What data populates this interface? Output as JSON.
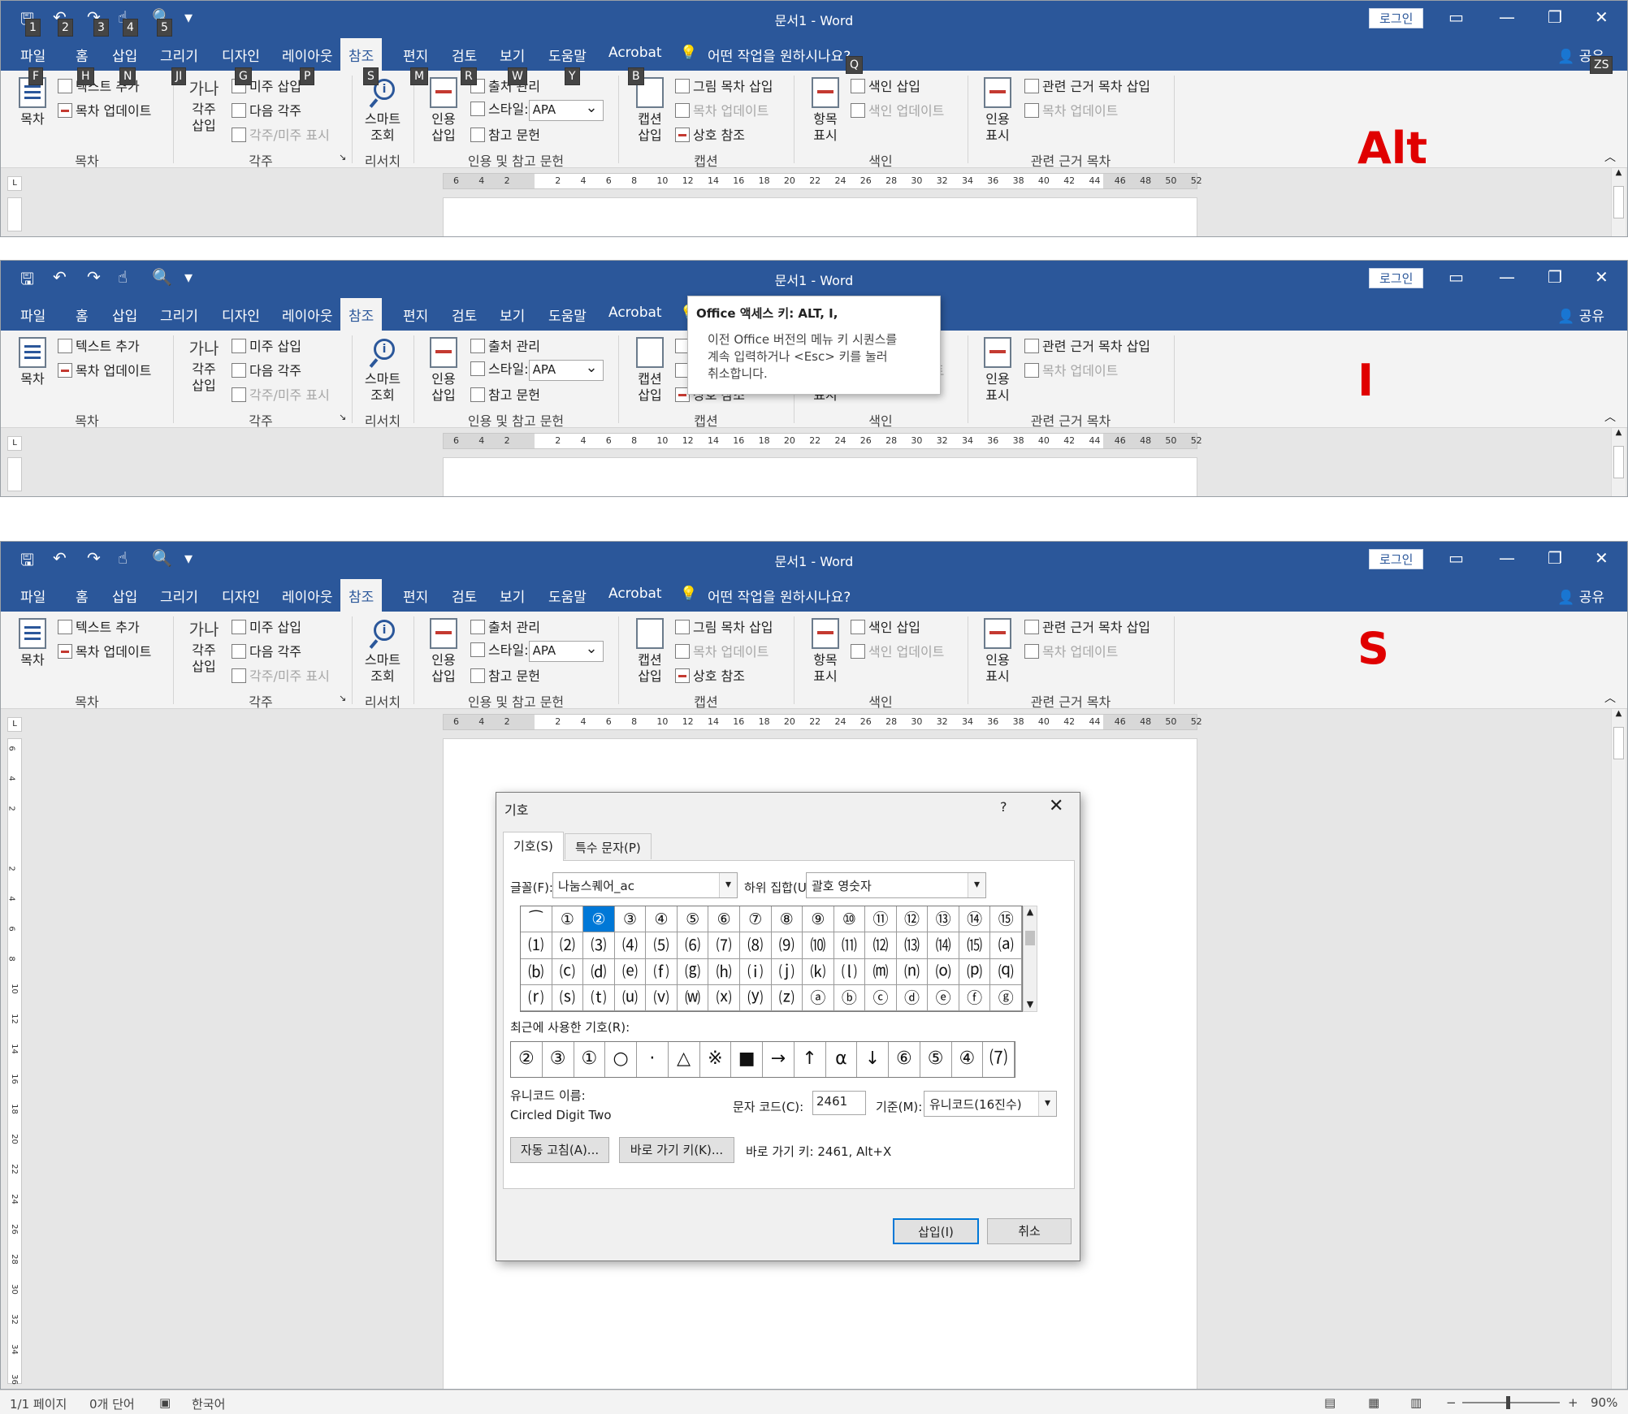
{
  "app": {
    "title": "문서1  -  Word",
    "login": "로그인",
    "share": "공유",
    "tell_me": "어떤 작업을 원하시나요?",
    "qat_icons": [
      "save-icon",
      "undo-icon",
      "redo-icon",
      "touch-mode-icon",
      "print-preview-icon",
      "customize-qat-icon"
    ],
    "qat_keytips": [
      "1",
      "2",
      "3",
      "4",
      "5"
    ]
  },
  "tabs": [
    {
      "label": "파일",
      "keytip": "F"
    },
    {
      "label": "홈",
      "keytip": "H"
    },
    {
      "label": "삽입",
      "keytip": "N"
    },
    {
      "label": "그리기",
      "keytip": "JI"
    },
    {
      "label": "디자인",
      "keytip": "G"
    },
    {
      "label": "레이아웃",
      "keytip": "P"
    },
    {
      "label": "참조",
      "keytip": "S"
    },
    {
      "label": "편지",
      "keytip": "M"
    },
    {
      "label": "검토",
      "keytip": "R"
    },
    {
      "label": "보기",
      "keytip": "W"
    },
    {
      "label": "도움말",
      "keytip": "Y"
    },
    {
      "label": "Acrobat",
      "keytip": "B"
    }
  ],
  "extra_keytips": {
    "tell_me": "Q",
    "share": "ZS"
  },
  "ribbon": {
    "toc": {
      "big": "목차",
      "add_text": "텍스트 추가",
      "update": "목차 업데이트",
      "group": "목차"
    },
    "footnotes": {
      "big_icon": "가나",
      "big": "각주\n삽입",
      "insert_endnote": "미주 삽입",
      "next": "다음 각주",
      "show": "각주/미주 표시",
      "group": "각주"
    },
    "research": {
      "big": "스마트\n조회",
      "group": "리서치"
    },
    "citations": {
      "big": "인용\n삽입",
      "manage": "출처 관리",
      "style_label": "스타일:",
      "style_value": "APA",
      "biblio": "참고 문헌",
      "group": "인용 및 참고 문헌"
    },
    "captions": {
      "big": "캡션\n삽입",
      "insert_tof": "그림 목차 삽입",
      "update": "목차 업데이트",
      "cross": "상호 참조",
      "group": "캡션"
    },
    "index": {
      "big": "항목\n표시",
      "insert": "색인 삽입",
      "update": "색인 업데이트",
      "group": "색인"
    },
    "toa": {
      "big": "인용\n표시",
      "insert": "관련 근거 목차 삽입",
      "update": "목차 업데이트",
      "group": "관련 근거 목차"
    }
  },
  "panels": {
    "label1": "Alt",
    "label2": "I",
    "label3": "S"
  },
  "tooltip": {
    "title": "Office 액세스 키: ALT, I,",
    "body": "이전 Office 버전의 메뉴 키 시퀀스를\n계속 입력하거나 <Esc> 키를 눌러\n취소합니다."
  },
  "ruler_ticks": [
    "6",
    "4",
    "2",
    "",
    "2",
    "4",
    "6",
    "8",
    "10",
    "12",
    "14",
    "16",
    "18",
    "20",
    "22",
    "24",
    "26",
    "28",
    "30",
    "32",
    "34",
    "36",
    "38",
    "40",
    "42",
    "44",
    "46",
    "48",
    "50",
    "52"
  ],
  "vruler_ticks": [
    "6",
    "4",
    "2",
    "",
    "2",
    "4",
    "6",
    "8",
    "10",
    "12",
    "14",
    "16",
    "18",
    "20",
    "22",
    "24",
    "26",
    "28",
    "30",
    "32",
    "34",
    "36"
  ],
  "dialog": {
    "title": "기호",
    "help": "?",
    "tab_symbols": "기호(S)",
    "tab_special": "특수 문자(P)",
    "font_label": "글꼴(F):",
    "font_value": "나눔스퀘어_ac",
    "subset_label": "하위 집합(U):",
    "subset_value": "괄호 영숫자",
    "symbols": [
      "⁀",
      "①",
      "②",
      "③",
      "④",
      "⑤",
      "⑥",
      "⑦",
      "⑧",
      "⑨",
      "⑩",
      "⑪",
      "⑫",
      "⑬",
      "⑭",
      "⑮",
      "⑴",
      "⑵",
      "⑶",
      "⑷",
      "⑸",
      "⑹",
      "⑺",
      "⑻",
      "⑼",
      "⑽",
      "⑾",
      "⑿",
      "⒀",
      "⒁",
      "⒂",
      "⒜",
      "⒝",
      "⒞",
      "⒟",
      "⒠",
      "⒡",
      "⒢",
      "⒣",
      "⒤",
      "⒥",
      "⒦",
      "⒧",
      "⒨",
      "⒩",
      "⒪",
      "⒫",
      "⒬",
      "⒭",
      "⒮",
      "⒯",
      "⒰",
      "⒱",
      "⒲",
      "⒳",
      "⒴",
      "⒵",
      "ⓐ",
      "ⓑ",
      "ⓒ",
      "ⓓ",
      "ⓔ",
      "ⓕ",
      "ⓖ"
    ],
    "selected_index": 2,
    "recent_label": "최근에 사용한 기호(R):",
    "recent": [
      "②",
      "③",
      "①",
      "○",
      "·",
      "△",
      "※",
      "■",
      "→",
      "↑",
      "α",
      "↓",
      "⑥",
      "⑤",
      "④",
      "⑺"
    ],
    "unicode_name_label": "유니코드 이름:",
    "unicode_name": "Circled Digit Two",
    "code_label": "문자 코드(C):",
    "code_value": "2461",
    "from_label": "기준(M):",
    "from_value": "유니코드(16진수)",
    "autocorrect": "자동 고침(A)...",
    "shortcut_btn": "바로 가기 키(K)...",
    "shortcut_text": "바로 가기 키: 2461, Alt+X",
    "insert": "삽입(I)",
    "cancel": "취소"
  },
  "status": {
    "page": "1/1 페이지",
    "words": "0개 단어",
    "lang": "한국어",
    "zoom": "90%"
  }
}
